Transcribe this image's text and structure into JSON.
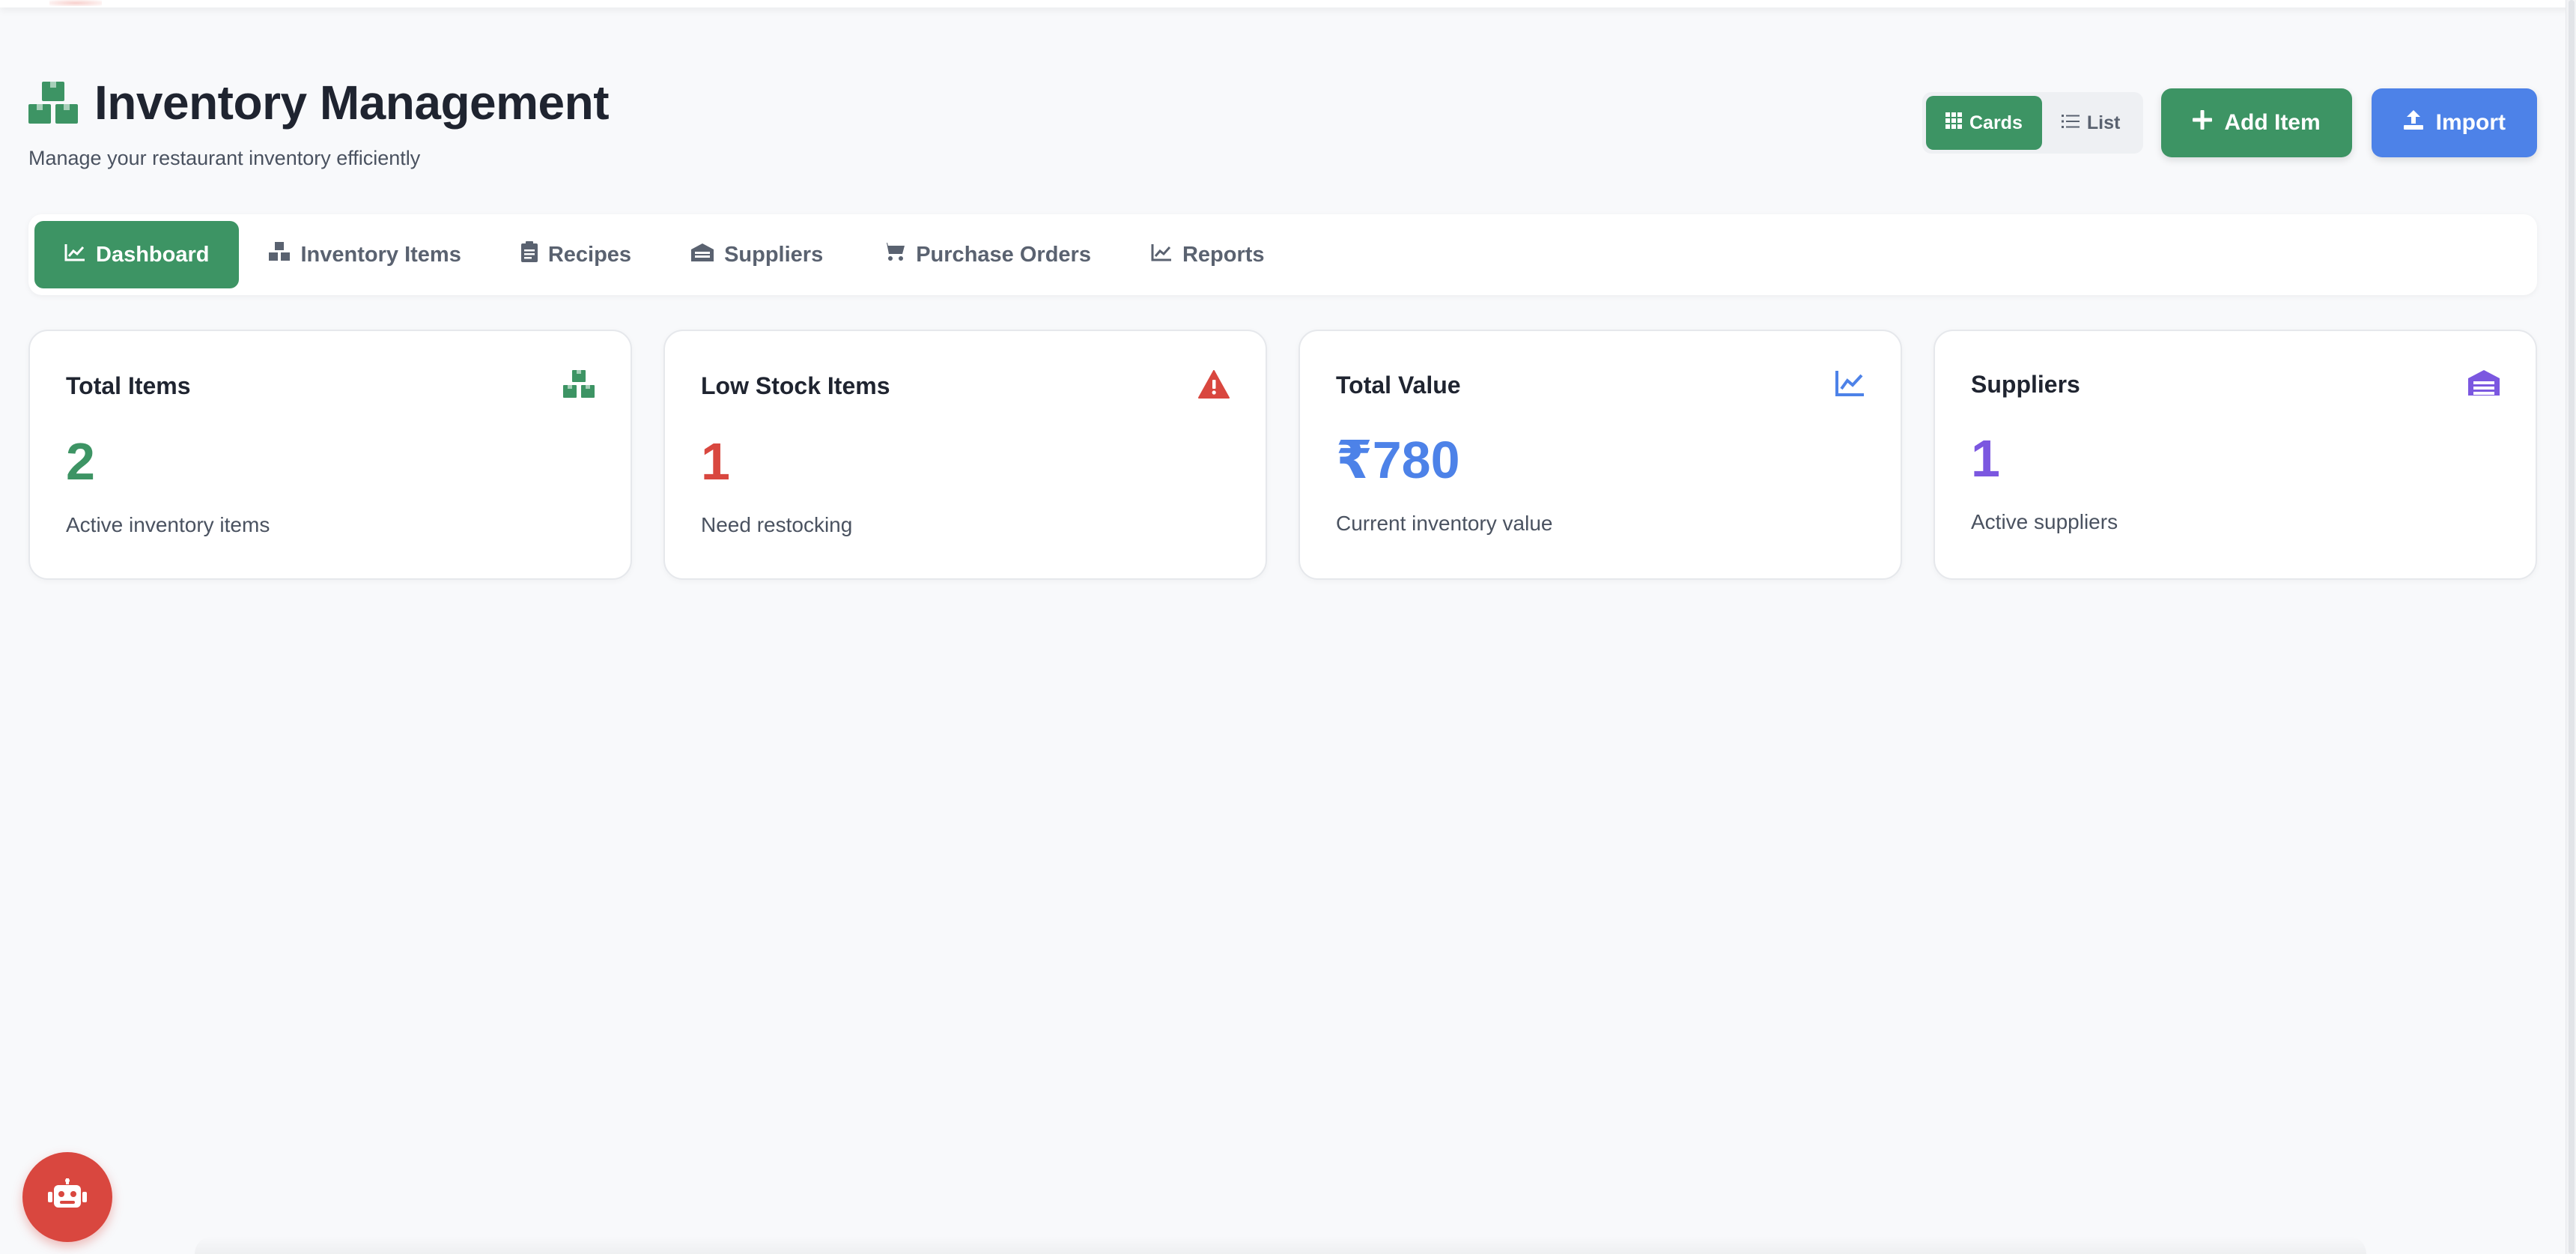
{
  "header": {
    "title": "Inventory Management",
    "subtitle": "Manage your restaurant inventory efficiently"
  },
  "view_toggle": {
    "cards_label": "Cards",
    "list_label": "List",
    "selected": "Cards"
  },
  "actions": {
    "add_item_label": "Add Item",
    "import_label": "Import"
  },
  "tabs": [
    {
      "label": "Dashboard",
      "icon": "chart-line-icon",
      "active": true
    },
    {
      "label": "Inventory Items",
      "icon": "boxes-icon",
      "active": false
    },
    {
      "label": "Recipes",
      "icon": "clipboard-icon",
      "active": false
    },
    {
      "label": "Suppliers",
      "icon": "warehouse-icon",
      "active": false
    },
    {
      "label": "Purchase Orders",
      "icon": "cart-icon",
      "active": false
    },
    {
      "label": "Reports",
      "icon": "chart-line-icon",
      "active": false
    }
  ],
  "cards": [
    {
      "title": "Total Items",
      "value": "2",
      "description": "Active inventory items",
      "icon": "boxes-icon",
      "color": "#3d9464"
    },
    {
      "title": "Low Stock Items",
      "value": "1",
      "description": "Need restocking",
      "icon": "warning-icon",
      "color": "#d9473f"
    },
    {
      "title": "Total Value",
      "value": "₹780",
      "description": "Current inventory value",
      "icon": "chart-line-icon",
      "color": "#4d82e8"
    },
    {
      "title": "Suppliers",
      "value": "1",
      "description": "Active suppliers",
      "icon": "warehouse-icon",
      "color": "#7b57e0"
    }
  ],
  "colors": {
    "primary": "#3d9464",
    "accent_blue": "#4d82e8",
    "danger": "#d9473f",
    "purple": "#7b57e0",
    "background": "#f8f9fb"
  },
  "assistant_button": {
    "icon": "robot-icon"
  }
}
